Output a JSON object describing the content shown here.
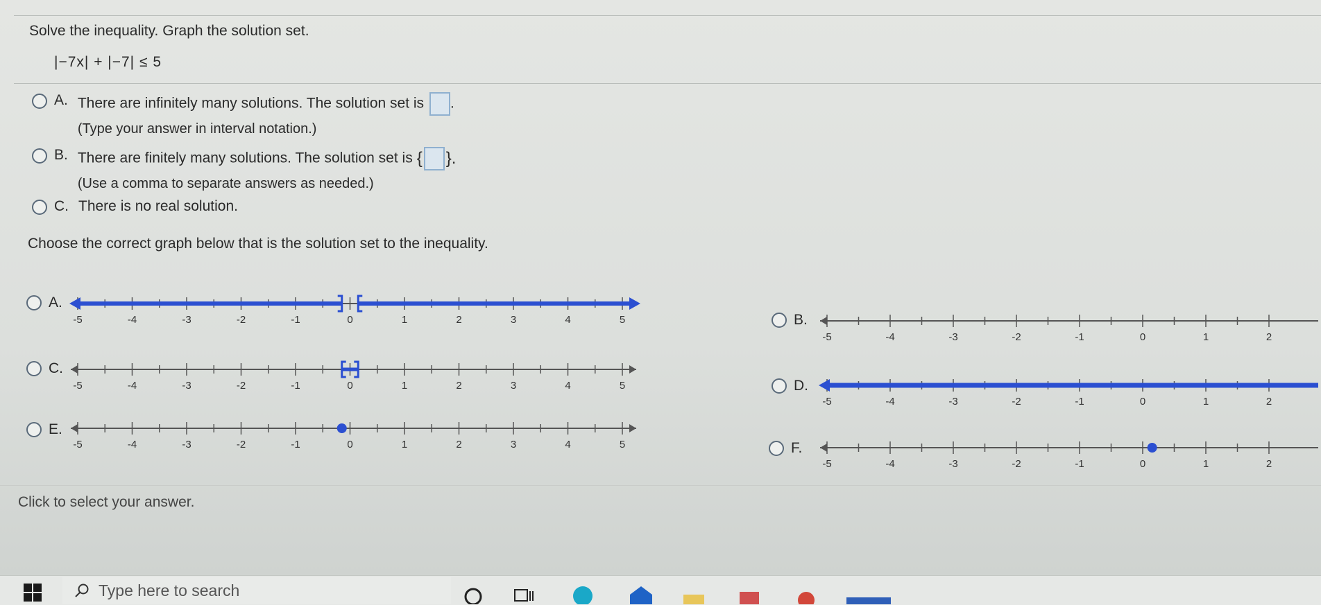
{
  "question": {
    "instruction": "Solve the inequality. Graph the solution set.",
    "inequality": "|−7x| + |−7| ≤ 5"
  },
  "choices": [
    {
      "letter": "A.",
      "text": "There are infinitely many solutions. The solution set is",
      "hint": "(Type your answer in interval notation.)"
    },
    {
      "letter": "B.",
      "text": "There are finitely many solutions. The solution set is",
      "hint": "(Use a comma to separate answers as needed.)"
    },
    {
      "letter": "C.",
      "text": "There is no real solution.",
      "hint": ""
    }
  ],
  "brace_open": "{",
  "brace_close": "}.",
  "period": ".",
  "graph_prompt": "Choose the correct graph below that is the solution set to the inequality.",
  "graph_letters": [
    "A.",
    "B.",
    "C.",
    "D.",
    "E.",
    "F."
  ],
  "axis_ticks": [
    "-5",
    "-4",
    "-3",
    "-2",
    "-1",
    "0",
    "1",
    "2",
    "3",
    "4",
    "5"
  ],
  "axis_ticks_right": [
    "-5",
    "-4",
    "-3",
    "-2",
    "-1",
    "0",
    "1",
    "2"
  ],
  "graphs": {
    "A": {
      "type": "two rays with gap",
      "left_end": -0.15,
      "right_start": 0.15,
      "bracket_left": "]",
      "bracket_right": "["
    },
    "B": {
      "type": "empty"
    },
    "C": {
      "type": "closed interval",
      "from": -0.15,
      "to": 0.15
    },
    "D": {
      "type": "entire line"
    },
    "E": {
      "type": "point",
      "at": -0.15
    },
    "F": {
      "type": "point",
      "at": 0.15
    }
  },
  "status": "Click to select your answer.",
  "taskbar": {
    "search_placeholder": "Type here to search"
  },
  "colors": {
    "accent": "#2b4fd1",
    "axis": "#555555",
    "answer_box": "#dbe6ef"
  }
}
